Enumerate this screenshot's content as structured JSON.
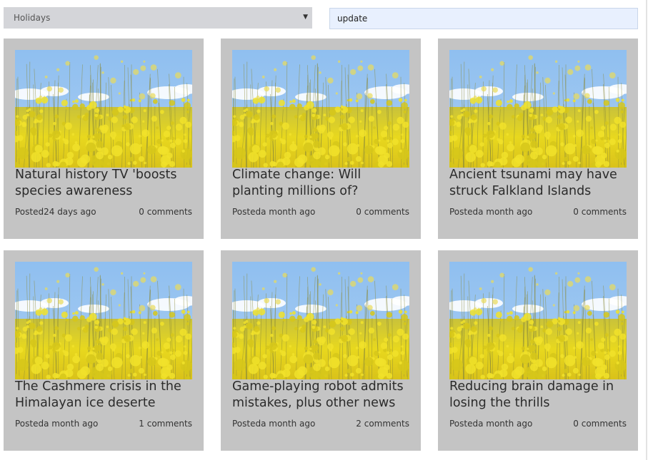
{
  "filter": {
    "selected": "Holidays"
  },
  "search": {
    "value": "update"
  },
  "articles": [
    {
      "title": "Natural history TV 'boosts species awareness",
      "posted": "Posted24 days ago",
      "comments": "0 comments"
    },
    {
      "title": "Climate change: Will planting millions of?",
      "posted": "Posteda month ago",
      "comments": "0 comments"
    },
    {
      "title": "Ancient tsunami may have struck Falkland Islands",
      "posted": "Posteda month ago",
      "comments": "0 comments"
    },
    {
      "title": "The Cashmere crisis in the Himalayan ice deserte",
      "posted": "Posteda month ago",
      "comments": "1 comments"
    },
    {
      "title": "Game-playing robot admits mistakes, plus other news",
      "posted": "Posteda month ago",
      "comments": "2 comments"
    },
    {
      "title": "Reducing brain damage in losing the thrills",
      "posted": "Posteda month ago",
      "comments": "0 comments"
    }
  ],
  "colors": {
    "card_bg": "#c4c4c4",
    "select_bg": "#d4d5d9",
    "search_bg": "#e8f0fe",
    "sky": "#a9cdf2",
    "flowers": "#e8d81e"
  }
}
